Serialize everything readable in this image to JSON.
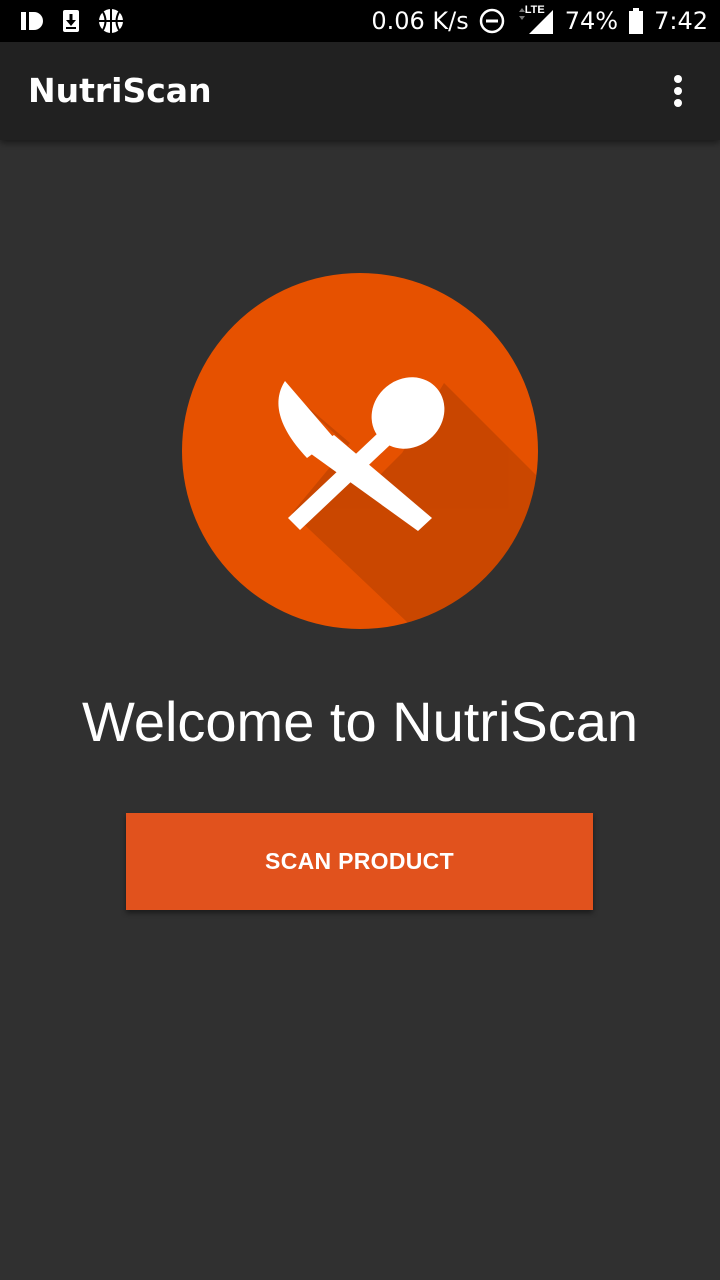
{
  "status_bar": {
    "network_speed": "0.06 K/s",
    "network_type": "LTE",
    "battery": "74%",
    "time": "7:42",
    "left_icons": [
      "id-icon",
      "download-icon",
      "basketball-icon"
    ],
    "right_icons": [
      "dnd-icon",
      "signal-icon",
      "battery-icon"
    ]
  },
  "toolbar": {
    "title": "NutriScan",
    "menu_icon": "more-vert-icon"
  },
  "main": {
    "logo_icon": "utensils-icon",
    "welcome_text": "Welcome to NutriScan",
    "scan_button_label": "SCAN PRODUCT"
  },
  "colors": {
    "accent": "#e1521d",
    "logo_circle": "#e65100",
    "background": "#303030",
    "toolbar": "#212121"
  }
}
